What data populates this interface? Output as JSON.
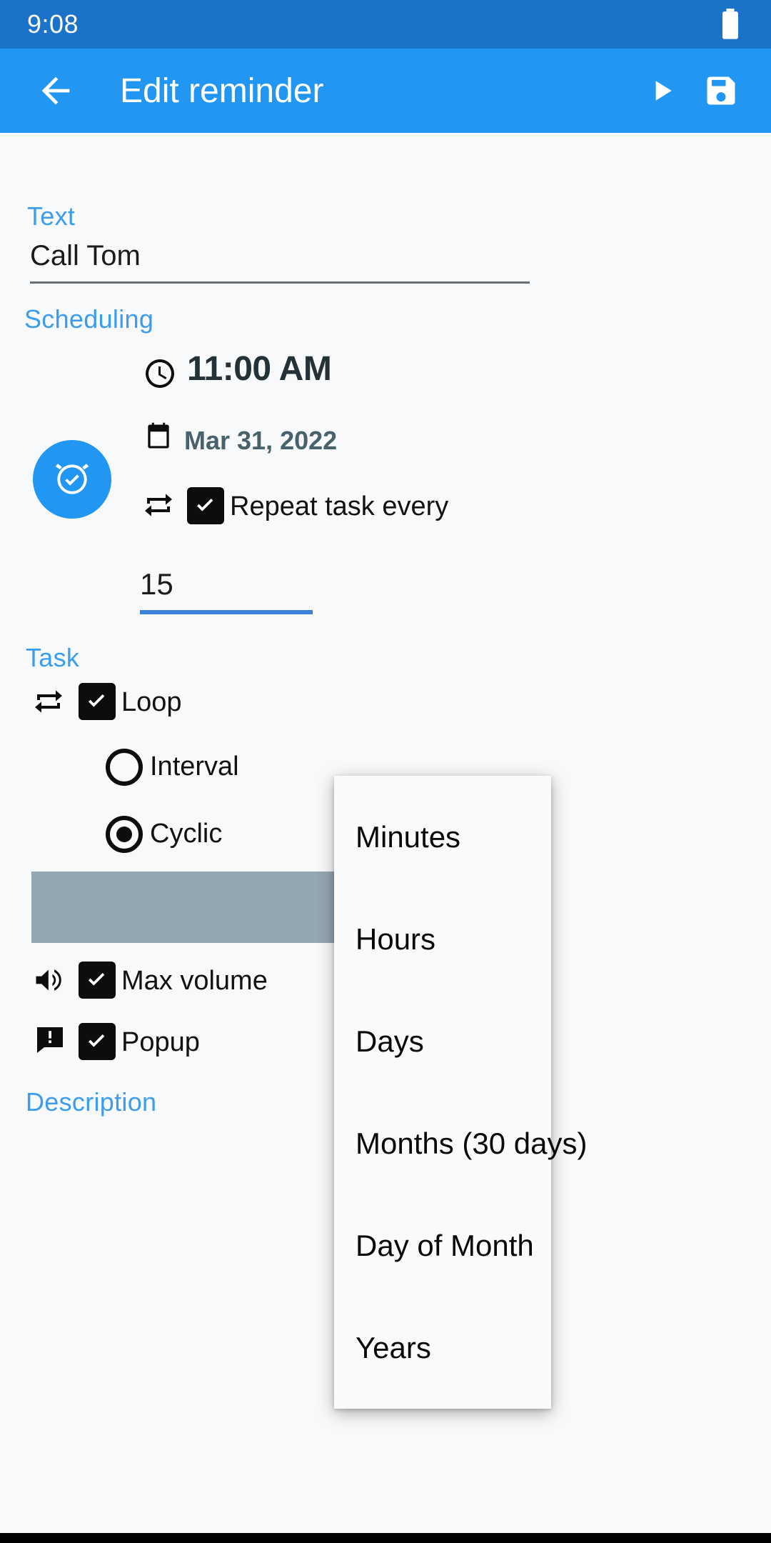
{
  "status_bar": {
    "clock": "9:08",
    "battery_icon": "battery-icon"
  },
  "app_bar": {
    "back_icon": "back-arrow-icon",
    "title": "Edit reminder",
    "play_icon": "play-icon",
    "save_icon": "save-icon"
  },
  "colors": {
    "status_bar": "#1a73c8",
    "app_bar": "#2196f3",
    "accent": "#3c9ced",
    "background": "#f8f9fa",
    "checkbox": "#0d0d0d",
    "gray_bar": "#94a6b1",
    "underline_active": "#3b82dd",
    "underline_inactive": "#6b6f72"
  },
  "text_section": {
    "label": "Text",
    "value": "Call Tom",
    "placeholder": "Text"
  },
  "scheduling_section": {
    "label": "Scheduling",
    "alarm_icon": "alarm-check-icon",
    "time": {
      "icon": "clock-icon",
      "value": "11:00 AM"
    },
    "date": {
      "icon": "calendar-icon",
      "value": "Mar 31, 2022"
    },
    "repeat": {
      "icon": "repeat-icon",
      "label": "Repeat task every",
      "checked": true
    },
    "interval_value": "15"
  },
  "task_section": {
    "label": "Task",
    "loop": {
      "icon": "repeat-icon",
      "label": "Loop",
      "checked": true
    },
    "interval_option": {
      "label": "Interval",
      "selected": false
    },
    "cyclic_option": {
      "label": "Cyclic",
      "selected": true
    },
    "loop_unit_selector": {
      "icon": "repeat-one-icon",
      "dropdown_icon": "chevron-down-icon"
    },
    "max_volume": {
      "icon": "volume-up-icon",
      "label": "Max volume",
      "checked": true
    },
    "popup": {
      "icon": "message-alert-icon",
      "label": "Popup",
      "checked": true
    }
  },
  "description_section": {
    "label": "Description"
  },
  "unit_dropdown": {
    "items": [
      {
        "label": "Minutes"
      },
      {
        "label": "Hours"
      },
      {
        "label": "Days"
      },
      {
        "label": "Months (30 days)"
      },
      {
        "label": "Day of Month"
      },
      {
        "label": "Years"
      }
    ]
  }
}
